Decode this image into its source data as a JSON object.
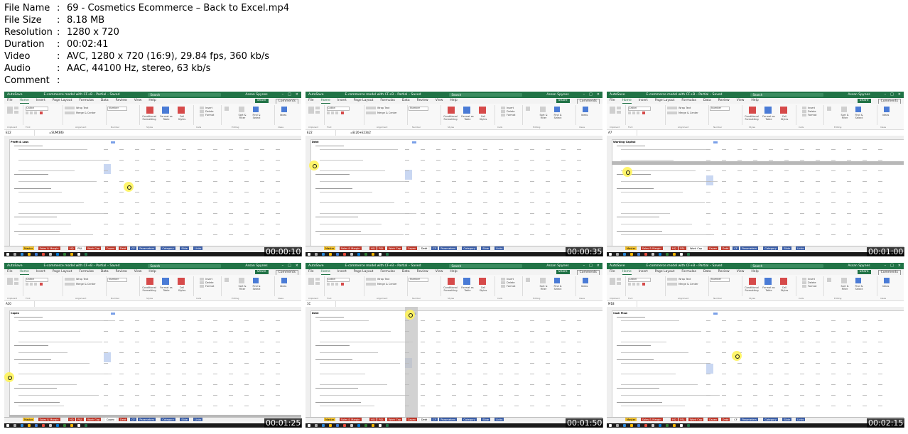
{
  "info": {
    "rows": [
      {
        "key": "File Name",
        "value": "69 - Cosmetics Ecommerce – Back to Excel.mp4"
      },
      {
        "key": "File Size",
        "value": "8.18 MB"
      },
      {
        "key": "Resolution",
        "value": "1280 x 720"
      },
      {
        "key": "Duration",
        "value": "00:02:41"
      },
      {
        "key": "Video",
        "value": "AVC, 1280 x 720 (16:9), 29.84 fps, 360 kb/s"
      },
      {
        "key": "Audio",
        "value": "AAC, 44100 Hz, stereo, 63 kb/s"
      },
      {
        "key": "Comment",
        "value": ""
      }
    ]
  },
  "excel": {
    "autosave": "AutoSave",
    "title": "E-commerce model with CF+B – Partial – Saved",
    "search": "Search",
    "user": "Assan Spynes",
    "menu": [
      "File",
      "Home",
      "Insert",
      "Page Layout",
      "Formulas",
      "Data",
      "Review",
      "View",
      "Help"
    ],
    "share": "Share",
    "comments": "Comments",
    "ribbon": {
      "font": "Calibri",
      "wrap": "Wrap Text",
      "merge": "Merge & Center",
      "number": "Number",
      "cond": "Conditional Formatting",
      "format_table": "Format as Table",
      "cell_styles": "Cell Styles",
      "insert": "Insert",
      "delete": "Delete",
      "format": "Format",
      "sort": "Sort & Filter",
      "find": "Find & Select",
      "ideas": "Ideas",
      "groups": [
        "Clipboard",
        "Font",
        "Alignment",
        "Number",
        "Styles",
        "Cells",
        "Editing",
        "Ideas"
      ]
    }
  },
  "thumbs": [
    {
      "timestamp": "00:00:10",
      "cell": "E22",
      "formula": "=SUM(B6)",
      "sheet_title": "Profit & Loss",
      "tabs": [
        "Master",
        "Sales & Margin",
        "HQ",
        "P&L",
        "Work Cap",
        "Capex",
        "Debt",
        "CF",
        "Parameters",
        "Category",
        "Slide",
        "Links"
      ],
      "active_tab": 3
    },
    {
      "timestamp": "00:00:35",
      "cell": "E22",
      "formula": "=E(20+E23)/2",
      "sheet_title": "Debt",
      "tabs": [
        "Master",
        "Sales & Margin",
        "HQ",
        "P&L",
        "Work Cap",
        "Capex",
        "Debt",
        "CF",
        "Parameters",
        "Category",
        "Slide",
        "Links"
      ],
      "active_tab": 6
    },
    {
      "timestamp": "00:01:00",
      "cell": "A7",
      "formula": "",
      "sheet_title": "Working Capital",
      "tabs": [
        "Master",
        "Sales & Margin",
        "HQ",
        "P&L",
        "Work Cap",
        "Capex",
        "Debt",
        "CF",
        "Parameters",
        "Category",
        "Slide",
        "Links"
      ],
      "active_tab": 4
    },
    {
      "timestamp": "00:01:25",
      "cell": "A10",
      "formula": "",
      "sheet_title": "Capex",
      "tabs": [
        "Master",
        "Sales & Margin",
        "HQ",
        "P&L",
        "Work Cap",
        "Capex",
        "Debt",
        "CF",
        "Parameters",
        "Category",
        "Slide",
        "Links"
      ],
      "active_tab": 5
    },
    {
      "timestamp": "00:01:50",
      "cell": "1C",
      "formula": "",
      "sheet_title": "Debt",
      "tabs": [
        "Master",
        "Sales & Margin",
        "HQ",
        "P&L",
        "Work Cap",
        "Capex",
        "Debt",
        "CF",
        "Parameters",
        "Category",
        "Slide",
        "Links"
      ],
      "active_tab": 6
    },
    {
      "timestamp": "00:02:15",
      "cell": "M18",
      "formula": "",
      "sheet_title": "Cash Flow",
      "tabs": [
        "Master",
        "Sales & Margin",
        "HQ",
        "P&L",
        "Work Cap",
        "Capex",
        "Debt",
        "CF",
        "Parameters",
        "Category",
        "Slide",
        "Links"
      ],
      "active_tab": 7
    }
  ],
  "colors": {
    "excel_green": "#217346",
    "tab_master": "#f2c230",
    "tab_red": "#c0392b",
    "tab_blue": "#3c5fa8",
    "highlight": "#fff45c"
  }
}
